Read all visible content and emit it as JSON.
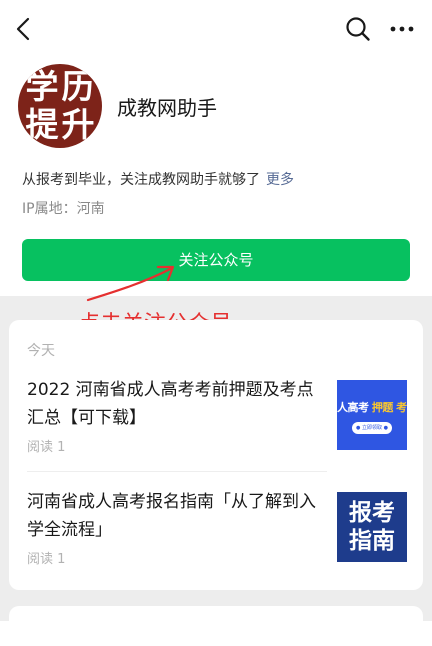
{
  "account": {
    "avatar_glyphs": [
      "学",
      "历",
      "提",
      "升"
    ],
    "name": "成教网助手",
    "bio": "从报考到毕业，关注成教网助手就够了",
    "more_link": "更多",
    "ip_location": "IP属地：河南",
    "follow_label": "关注公众号"
  },
  "annotation": {
    "text": "点击关注公众号",
    "color": "#e53030"
  },
  "feed": {
    "day_label": "今天",
    "articles": [
      {
        "title": "2022 河南省成人高考考前押题及考点汇总【可下载】",
        "meta": "阅读 1",
        "thumb_prefix": "人高考",
        "thumb_accent": "押题 考",
        "thumb_pill": "● 立即领取 ●"
      },
      {
        "title": "河南省成人高考报名指南「从了解到入学全流程」",
        "meta": "阅读 1",
        "thumb_line1": "报考",
        "thumb_line2": "指南"
      }
    ]
  },
  "colors": {
    "brand_green": "#07c160",
    "link_blue": "#576b95",
    "avatar_bg": "#7d2319",
    "feed_bg": "#ededed"
  },
  "icons": [
    "back-icon",
    "search-icon",
    "more-icon"
  ]
}
